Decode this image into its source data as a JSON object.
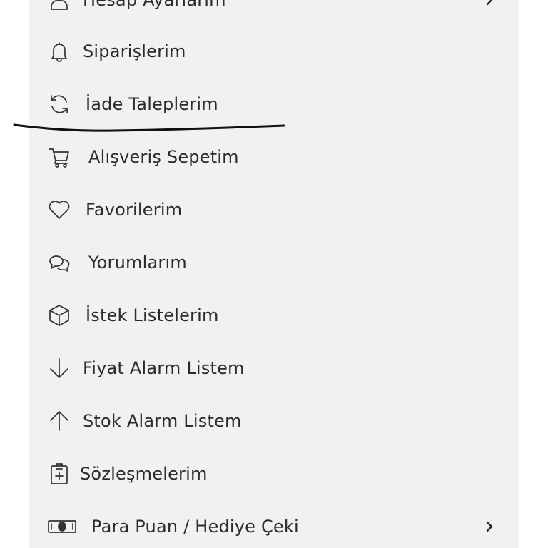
{
  "menu": {
    "items": [
      {
        "label": "Hesap Ayarlarım",
        "icon": "user-icon",
        "chevron": true
      },
      {
        "label": "Siparişlerim",
        "icon": "bell-icon",
        "chevron": false
      },
      {
        "label": "İade Taleplerim",
        "icon": "refresh-icon",
        "chevron": false
      },
      {
        "label": "Alışveriş Sepetim",
        "icon": "cart-icon",
        "chevron": false
      },
      {
        "label": "Favorilerim",
        "icon": "heart-icon",
        "chevron": false
      },
      {
        "label": "Yorumlarım",
        "icon": "chat-bubbles-icon",
        "chevron": false
      },
      {
        "label": "İstek Listelerim",
        "icon": "cube-icon",
        "chevron": false
      },
      {
        "label": "Fiyat Alarm Listem",
        "icon": "arrow-down-icon",
        "chevron": false
      },
      {
        "label": "Stok Alarm Listem",
        "icon": "arrow-up-icon",
        "chevron": false
      },
      {
        "label": "Sözleşmelerim",
        "icon": "clipboard-plus-icon",
        "chevron": false
      },
      {
        "label": "Para Puan / Hediye Çeki",
        "icon": "money-icon",
        "chevron": true
      }
    ]
  },
  "colors": {
    "panel_bg": "#f1f1f1",
    "text": "#2b2b2b",
    "icon_stroke": "#333333",
    "annotation": "#111111"
  }
}
